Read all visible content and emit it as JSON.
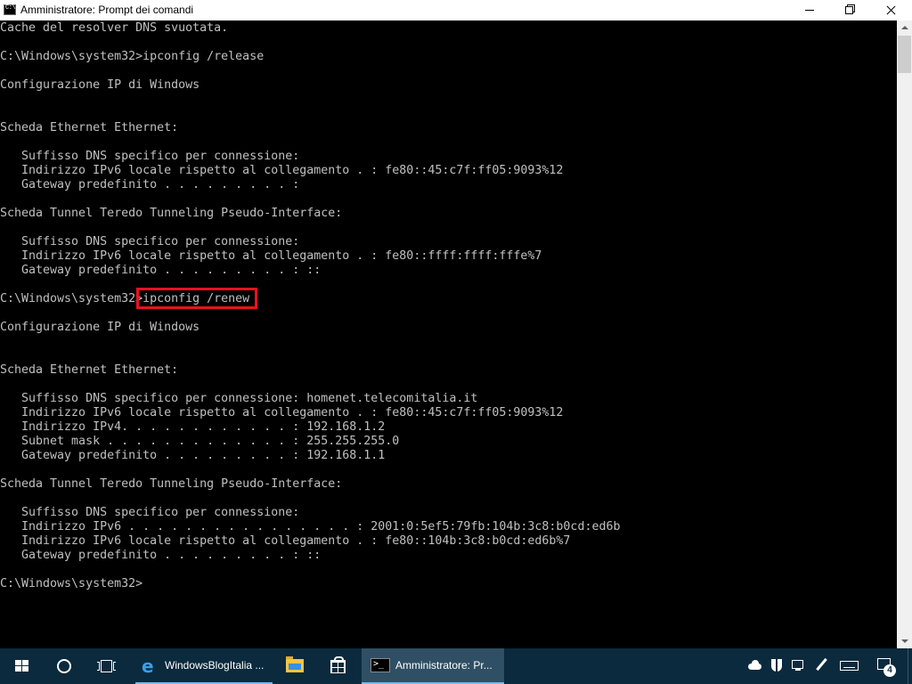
{
  "window": {
    "title": "Amministratore: Prompt dei comandi"
  },
  "console": {
    "lines": [
      "Cache del resolver DNS svuotata.",
      "",
      "C:\\Windows\\system32>ipconfig /release",
      "",
      "Configurazione IP di Windows",
      "",
      "",
      "Scheda Ethernet Ethernet:",
      "",
      "   Suffisso DNS specifico per connessione:",
      "   Indirizzo IPv6 locale rispetto al collegamento . : fe80::45:c7f:ff05:9093%12",
      "   Gateway predefinito . . . . . . . . . :",
      "",
      "Scheda Tunnel Teredo Tunneling Pseudo-Interface:",
      "",
      "   Suffisso DNS specifico per connessione:",
      "   Indirizzo IPv6 locale rispetto al collegamento . : fe80::ffff:ffff:fffe%7",
      "   Gateway predefinito . . . . . . . . . : ::",
      "",
      "C:\\Windows\\system32>ipconfig /renew",
      "",
      "Configurazione IP di Windows",
      "",
      "",
      "Scheda Ethernet Ethernet:",
      "",
      "   Suffisso DNS specifico per connessione: homenet.telecomitalia.it",
      "   Indirizzo IPv6 locale rispetto al collegamento . : fe80::45:c7f:ff05:9093%12",
      "   Indirizzo IPv4. . . . . . . . . . . . : 192.168.1.2",
      "   Subnet mask . . . . . . . . . . . . . : 255.255.255.0",
      "   Gateway predefinito . . . . . . . . . : 192.168.1.1",
      "",
      "Scheda Tunnel Teredo Tunneling Pseudo-Interface:",
      "",
      "   Suffisso DNS specifico per connessione:",
      "   Indirizzo IPv6 . . . . . . . . . . . . . . . . : 2001:0:5ef5:79fb:104b:3c8:b0cd:ed6b",
      "   Indirizzo IPv6 locale rispetto al collegamento . : fe80::104b:3c8:b0cd:ed6b%7",
      "   Gateway predefinito . . . . . . . . . : ::",
      "",
      "C:\\Windows\\system32>"
    ],
    "highlighted_command": "ipconfig /renew",
    "text_color": "#c0c0c0",
    "background_color": "#000000",
    "highlight_color": "#e81123"
  },
  "taskbar": {
    "edge_task_label": "WindowsBlogItalia ...",
    "cmd_task_label": "Amministratore: Pr...",
    "notification_count": "4",
    "background_color": "#0b2a3d",
    "active_accent": "#76b9ed"
  },
  "icons": {
    "titlebar": "cmd-icon",
    "start": "windows-logo-icon",
    "search": "search-icon",
    "task_view": "task-view-icon",
    "edge": "edge-icon",
    "explorer": "folder-icon",
    "store": "store-icon",
    "cmd": "cmd-icon",
    "tray": [
      "onedrive-icon",
      "defender-icon",
      "network-icon",
      "pen-icon",
      "keyboard-icon",
      "notification-icon"
    ]
  }
}
